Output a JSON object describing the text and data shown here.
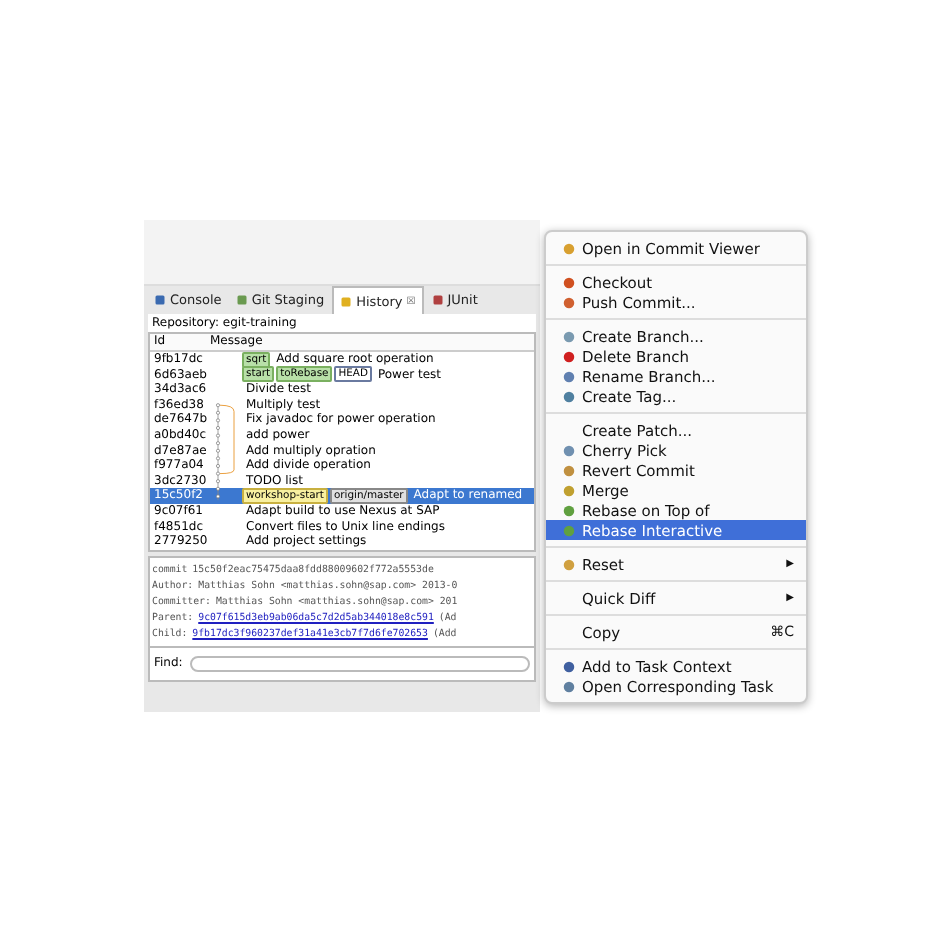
{
  "tabs": [
    {
      "label": "Console",
      "kind": "console",
      "selected": false
    },
    {
      "label": "Git Staging",
      "kind": "staging",
      "selected": false
    },
    {
      "label": "History",
      "kind": "history",
      "selected": true,
      "close": "☒"
    },
    {
      "label": "JUnit",
      "kind": "junit",
      "selected": false
    }
  ],
  "repository": "Repository: egit-training",
  "table": {
    "columns": [
      "Id",
      "Message"
    ],
    "rows": [
      {
        "id": "9fb17dc",
        "tags": [
          {
            "label": "sqrt",
            "kind": "branch"
          }
        ],
        "message": "Add square root operation",
        "selected": false
      },
      {
        "id": "6d63aeb",
        "tags": [
          {
            "label": "start",
            "kind": "branch"
          },
          {
            "label": "toRebase",
            "kind": "branch"
          },
          {
            "label": "HEAD",
            "kind": "head"
          }
        ],
        "message": "Power test",
        "selected": false
      },
      {
        "id": "34d3ac6",
        "tags": [],
        "message": "Divide test",
        "selected": false
      },
      {
        "id": "f36ed38",
        "tags": [],
        "message": "Multiply test",
        "selected": false
      },
      {
        "id": "de7647b",
        "tags": [],
        "message": "Fix javadoc for power operation",
        "selected": false
      },
      {
        "id": "a0bd40c",
        "tags": [],
        "message": "add power",
        "selected": false
      },
      {
        "id": "d7e87ae",
        "tags": [],
        "message": "Add multiply opration",
        "selected": false
      },
      {
        "id": "f977a04",
        "tags": [],
        "message": "Add divide operation",
        "selected": false
      },
      {
        "id": "3dc2730",
        "tags": [],
        "message": "TODO list",
        "selected": false
      },
      {
        "id": "15c50f2",
        "tags": [
          {
            "label": "workshop-start",
            "kind": "tag"
          },
          {
            "label": "origin/master",
            "kind": "remote"
          }
        ],
        "message": "Adapt to renamed",
        "selected": true
      },
      {
        "id": "9c07f61",
        "tags": [],
        "message": "Adapt build to use Nexus at SAP",
        "selected": false
      },
      {
        "id": "f4851dc",
        "tags": [],
        "message": "Convert files to Unix line endings",
        "selected": false
      },
      {
        "id": "2779250",
        "tags": [],
        "message": "Add project settings",
        "selected": false
      }
    ]
  },
  "details": [
    {
      "label": "commit",
      "value": "15c50f2eac75475daa8fdd88009602f772a5553de",
      "kind": "text"
    },
    {
      "label": "Author:",
      "value": "Matthias Sohn <matthias.sohn@sap.com> 2013-0",
      "kind": "text"
    },
    {
      "label": "Committer:",
      "value": "Matthias Sohn <matthias.sohn@sap.com> 201",
      "kind": "text"
    },
    {
      "label": "Parent:",
      "value": "9c07f615d3eb9ab06da5c7d2d5ab344018e8c591",
      "suffix": "(Ad",
      "kind": "link"
    },
    {
      "label": "Child:",
      "value": "9fb17dc3f960237def31a41e3cb7f7d6fe702653",
      "suffix": "(Add",
      "kind": "link"
    }
  ],
  "find": {
    "label": "Find:"
  },
  "menu": [
    {
      "label": "Open in Commit Viewer",
      "kind": "folder",
      "selected": false
    },
    {
      "kind": "separator"
    },
    {
      "label": "Checkout",
      "kind": "checkout",
      "selected": false
    },
    {
      "label": "Push Commit...",
      "kind": "push",
      "selected": false
    },
    {
      "kind": "separator"
    },
    {
      "label": "Create Branch...",
      "kind": "branch",
      "selected": false
    },
    {
      "label": "Delete Branch",
      "kind": "delete",
      "selected": false
    },
    {
      "label": "Rename Branch...",
      "kind": "rename",
      "selected": false
    },
    {
      "label": "Create Tag...",
      "kind": "tag",
      "selected": false
    },
    {
      "kind": "separator"
    },
    {
      "label": "Create Patch...",
      "kind": "plain",
      "selected": false
    },
    {
      "label": "Cherry Pick",
      "kind": "cherry",
      "selected": false
    },
    {
      "label": "Revert Commit",
      "kind": "revert",
      "selected": false
    },
    {
      "label": "Merge",
      "kind": "merge",
      "selected": false
    },
    {
      "label": "Rebase on Top of",
      "kind": "rebase",
      "selected": false
    },
    {
      "label": "Rebase Interactive",
      "kind": "rebase",
      "selected": true
    },
    {
      "kind": "separator"
    },
    {
      "label": "Reset",
      "kind": "reset",
      "submenu": "▶",
      "selected": false
    },
    {
      "kind": "separator"
    },
    {
      "label": "Quick Diff",
      "kind": "plain",
      "submenu": "▶",
      "selected": false
    },
    {
      "kind": "separator"
    },
    {
      "label": "Copy",
      "kind": "plain",
      "shortcut": "⌘C",
      "selected": false
    },
    {
      "kind": "separator"
    },
    {
      "label": "Add to Task Context",
      "kind": "task",
      "selected": false
    },
    {
      "label": "Open Corresponding Task",
      "kind": "task2",
      "selected": false
    }
  ]
}
